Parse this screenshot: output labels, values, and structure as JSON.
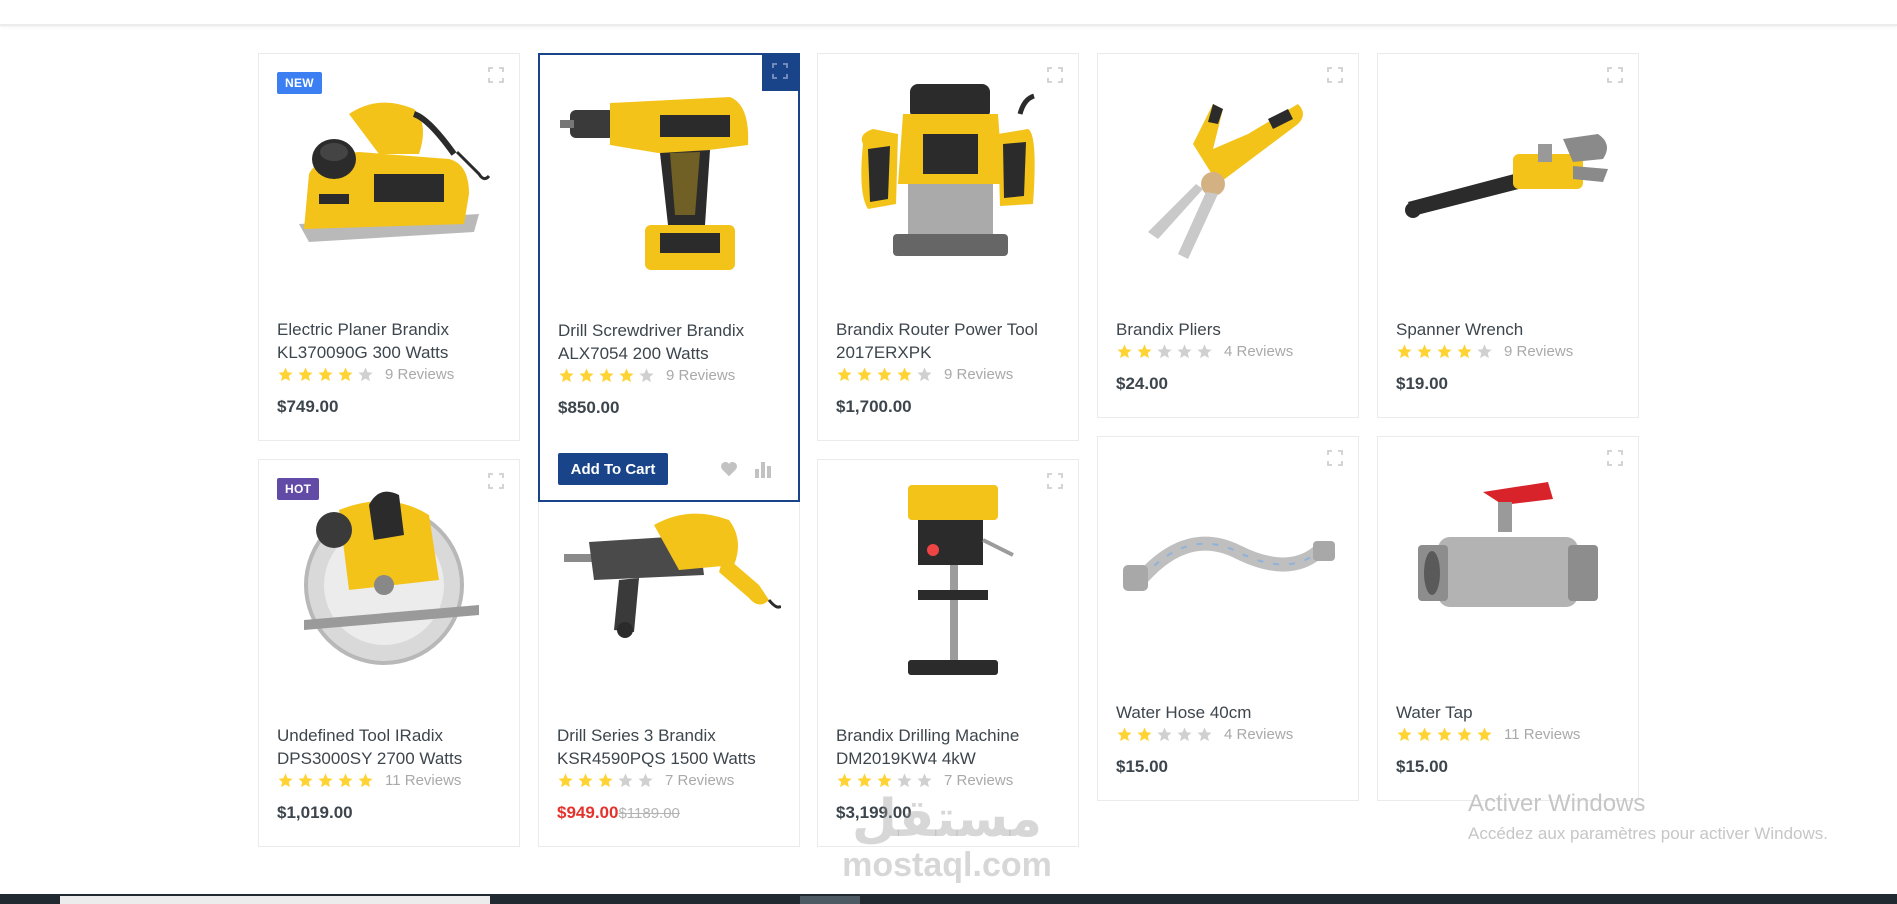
{
  "products": [
    {
      "title": "Electric Planer Brandix KL370090G 300 Watts",
      "badge": "NEW",
      "badge_type": "new",
      "rating": 4,
      "reviews": "9 Reviews",
      "price": "$749.00",
      "image": "planer",
      "icon": "expand-icon"
    },
    {
      "title": "Drill Screwdriver Brandix ALX7054 200 Watts",
      "rating": 4,
      "reviews": "9 Reviews",
      "price": "$850.00",
      "image": "drill",
      "active": true,
      "add_to_cart": "Add To Cart",
      "icon": "expand-icon"
    },
    {
      "title": "Brandix Router Power Tool 2017ERXPK",
      "rating": 4,
      "reviews": "9 Reviews",
      "price": "$1,700.00",
      "image": "router",
      "icon": "expand-icon"
    },
    {
      "title": "Brandix Pliers",
      "rating": 2,
      "reviews": "4 Reviews",
      "price": "$24.00",
      "image": "pliers",
      "icon": "expand-icon"
    },
    {
      "title": "Spanner Wrench",
      "rating": 4,
      "reviews": "9 Reviews",
      "price": "$19.00",
      "image": "wrench",
      "icon": "expand-icon"
    },
    {
      "title": "Undefined Tool IRadix DPS3000SY 2700 Watts",
      "badge": "HOT",
      "badge_type": "hot",
      "rating": 5,
      "reviews": "11 Reviews",
      "price": "$1,019.00",
      "image": "saw",
      "icon": "expand-icon"
    },
    {
      "title": "Drill Series 3 Brandix KSR4590PQS 1500 Watts",
      "rating": 3,
      "reviews": "7 Reviews",
      "price": "$949.00",
      "old_price": "$1189.00",
      "image": "hammer-drill",
      "icon": "expand-icon"
    },
    {
      "title": "Brandix Drilling Machine DM2019KW4 4kW",
      "rating": 3,
      "reviews": "7 Reviews",
      "price": "$3,199.00",
      "image": "drill-press",
      "icon": "expand-icon"
    },
    {
      "title": "Water Hose 40cm",
      "rating": 2,
      "reviews": "4 Reviews",
      "price": "$15.00",
      "image": "hose",
      "icon": "expand-icon"
    },
    {
      "title": "Water Tap",
      "rating": 5,
      "reviews": "11 Reviews",
      "price": "$15.00",
      "image": "tap",
      "icon": "expand-icon"
    }
  ],
  "colors": {
    "accent": "#1a4489",
    "star": "#ffd333",
    "star_empty": "#d0d0d0",
    "badge_new": "#3b7ff2",
    "badge_hot": "#614ba6",
    "sale": "#e5322d"
  },
  "overlay": {
    "activation_title": "Activer Windows",
    "activation_text": "Accédez aux paramètres pour activer Windows.",
    "watermark_ar": "مستقل",
    "watermark_latin": "mostaql.com"
  }
}
